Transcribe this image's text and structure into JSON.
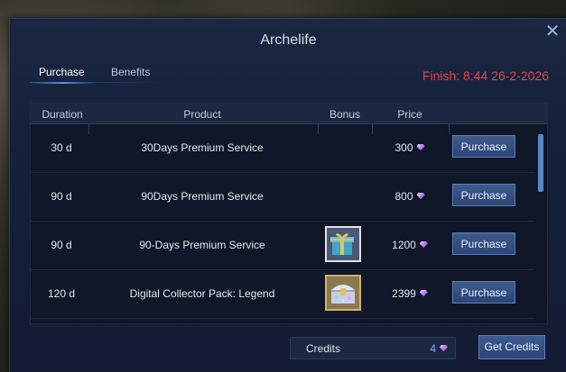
{
  "window": {
    "title": "Archelife",
    "close_symbol": "✕"
  },
  "tabs": [
    {
      "label": "Purchase",
      "active": true
    },
    {
      "label": "Benefits",
      "active": false
    }
  ],
  "finish_text": "Finish: 8:44 26-2-2026",
  "table": {
    "headers": {
      "duration": "Duration",
      "product": "Product",
      "bonus": "Bonus",
      "price": "Price"
    },
    "rows": [
      {
        "duration": "30 d",
        "product": "30Days Premium Service",
        "bonus_icon": "",
        "price": "300",
        "button": "Purchase"
      },
      {
        "duration": "90 d",
        "product": "90Days Premium Service",
        "bonus_icon": "",
        "price": "800",
        "button": "Purchase"
      },
      {
        "duration": "90 d",
        "product": "90-Days Premium Service",
        "bonus_icon": "gift-box-icon",
        "price": "1200",
        "button": "Purchase"
      },
      {
        "duration": "120 d",
        "product": "Digital Collector Pack: Legend",
        "bonus_icon": "treasure-chest-icon",
        "price": "2399",
        "button": "Purchase"
      }
    ]
  },
  "footer": {
    "credits_label": "Credits",
    "credits_value": "4",
    "get_credits_button": "Get Credits"
  },
  "colors": {
    "finish_text": "#e04545",
    "button": "#2c4577",
    "accent": "#4da0ff",
    "currency_gem": "#c07cf0"
  }
}
